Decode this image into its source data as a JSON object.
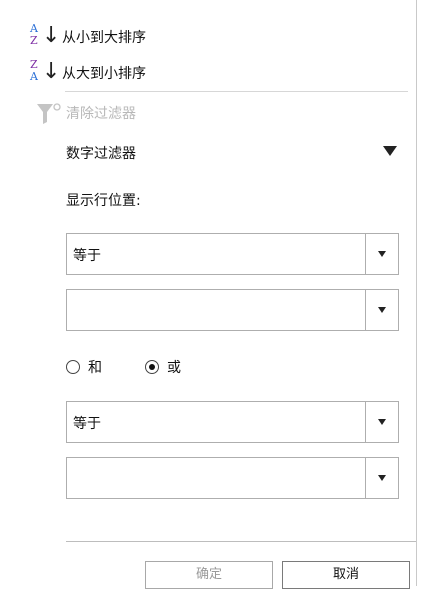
{
  "menu": {
    "sort_asc": {
      "label": "从小到大排序",
      "icon_top": "A",
      "icon_bottom": "Z"
    },
    "sort_desc": {
      "label": "从大到小排序",
      "icon_top": "Z",
      "icon_bottom": "A"
    },
    "clear_filter": {
      "label": "清除过滤器",
      "icon": "filter-clear-icon"
    }
  },
  "filter": {
    "section_title": "数字过滤器",
    "show_rows_label": "显示行位置:",
    "condition1": {
      "operator": "等于",
      "value": ""
    },
    "logic": {
      "and_label": "和",
      "or_label": "或",
      "selected": "or"
    },
    "condition2": {
      "operator": "等于",
      "value": ""
    }
  },
  "footer": {
    "ok_label": "确定",
    "cancel_label": "取消"
  },
  "colors": {
    "blue_letter": "#2b6fd6",
    "purple_letter": "#7e2fa5",
    "disabled_text": "#b8b8b8"
  }
}
